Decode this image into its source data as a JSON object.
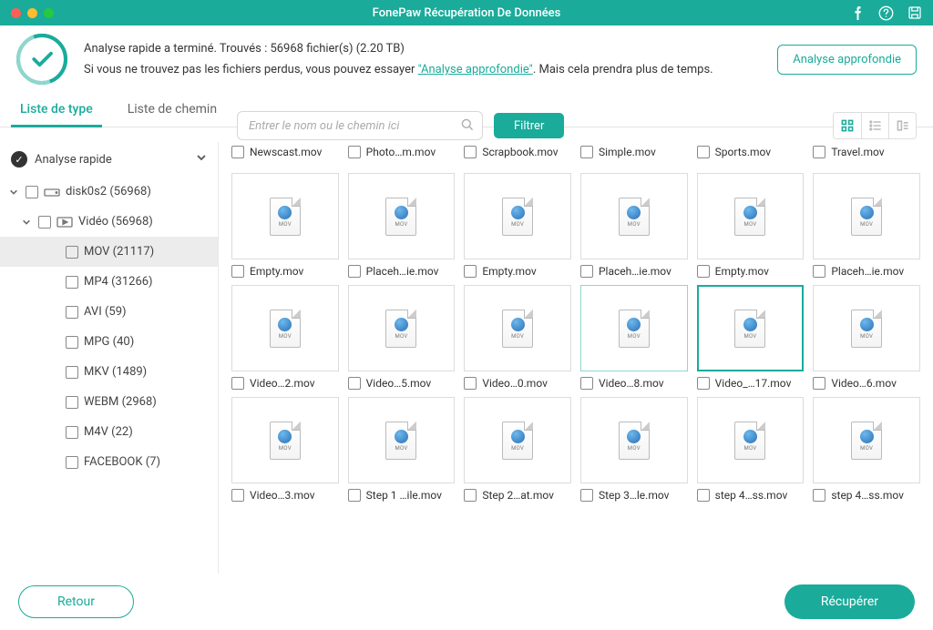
{
  "titlebar": {
    "title": "FonePaw Récupération De Données"
  },
  "status": {
    "line1": "Analyse rapide a terminé. Trouvés : 56968 fichier(s) (2.20 TB)",
    "line2_a": "Si vous ne trouvez pas les fichiers perdus, vous pouvez essayer ",
    "line2_link": "\"Analyse approfondie\"",
    "line2_b": ". Mais cela prendra plus de temps.",
    "deep_btn": "Analyse approfondie"
  },
  "tabs": {
    "type": "Liste de type",
    "path": "Liste de chemin"
  },
  "toolbar": {
    "search_placeholder": "Entrer le nom ou le chemin ici",
    "filter": "Filtrer"
  },
  "sidebar": {
    "quick": "Analyse rapide",
    "disk": "disk0s2 (56968)",
    "video": "Vidéo (56968)",
    "formats": [
      {
        "label": "MOV (21117)"
      },
      {
        "label": "MP4 (31266)"
      },
      {
        "label": "AVI (59)"
      },
      {
        "label": "MPG (40)"
      },
      {
        "label": "MKV (1489)"
      },
      {
        "label": "WEBM (2968)"
      },
      {
        "label": "M4V (22)"
      },
      {
        "label": "FACEBOOK (7)"
      }
    ]
  },
  "files_row0": [
    {
      "name": "Newscast.mov"
    },
    {
      "name": "Photo…m.mov"
    },
    {
      "name": "Scrapbook.mov"
    },
    {
      "name": "Simple.mov"
    },
    {
      "name": "Sports.mov"
    },
    {
      "name": "Travel.mov"
    }
  ],
  "files_rows": [
    [
      {
        "name": "Empty.mov"
      },
      {
        "name": "Placeh…ie.mov"
      },
      {
        "name": "Empty.mov"
      },
      {
        "name": "Placeh…ie.mov"
      },
      {
        "name": "Empty.mov"
      },
      {
        "name": "Placeh…ie.mov"
      }
    ],
    [
      {
        "name": "Video…2.mov"
      },
      {
        "name": "Video…5.mov"
      },
      {
        "name": "Video…0.mov"
      },
      {
        "name": "Video…8.mov",
        "sel": 1
      },
      {
        "name": "Video_…17.mov",
        "sel": 2
      },
      {
        "name": "Video…6.mov"
      }
    ],
    [
      {
        "name": "Video…3.mov"
      },
      {
        "name": "Step 1 …ile.mov"
      },
      {
        "name": "Step 2…at.mov"
      },
      {
        "name": "Step 3…le.mov"
      },
      {
        "name": "step 4…ss.mov"
      },
      {
        "name": "step 4…ss.mov"
      }
    ]
  ],
  "footer": {
    "back": "Retour",
    "recover": "Récupérer"
  }
}
